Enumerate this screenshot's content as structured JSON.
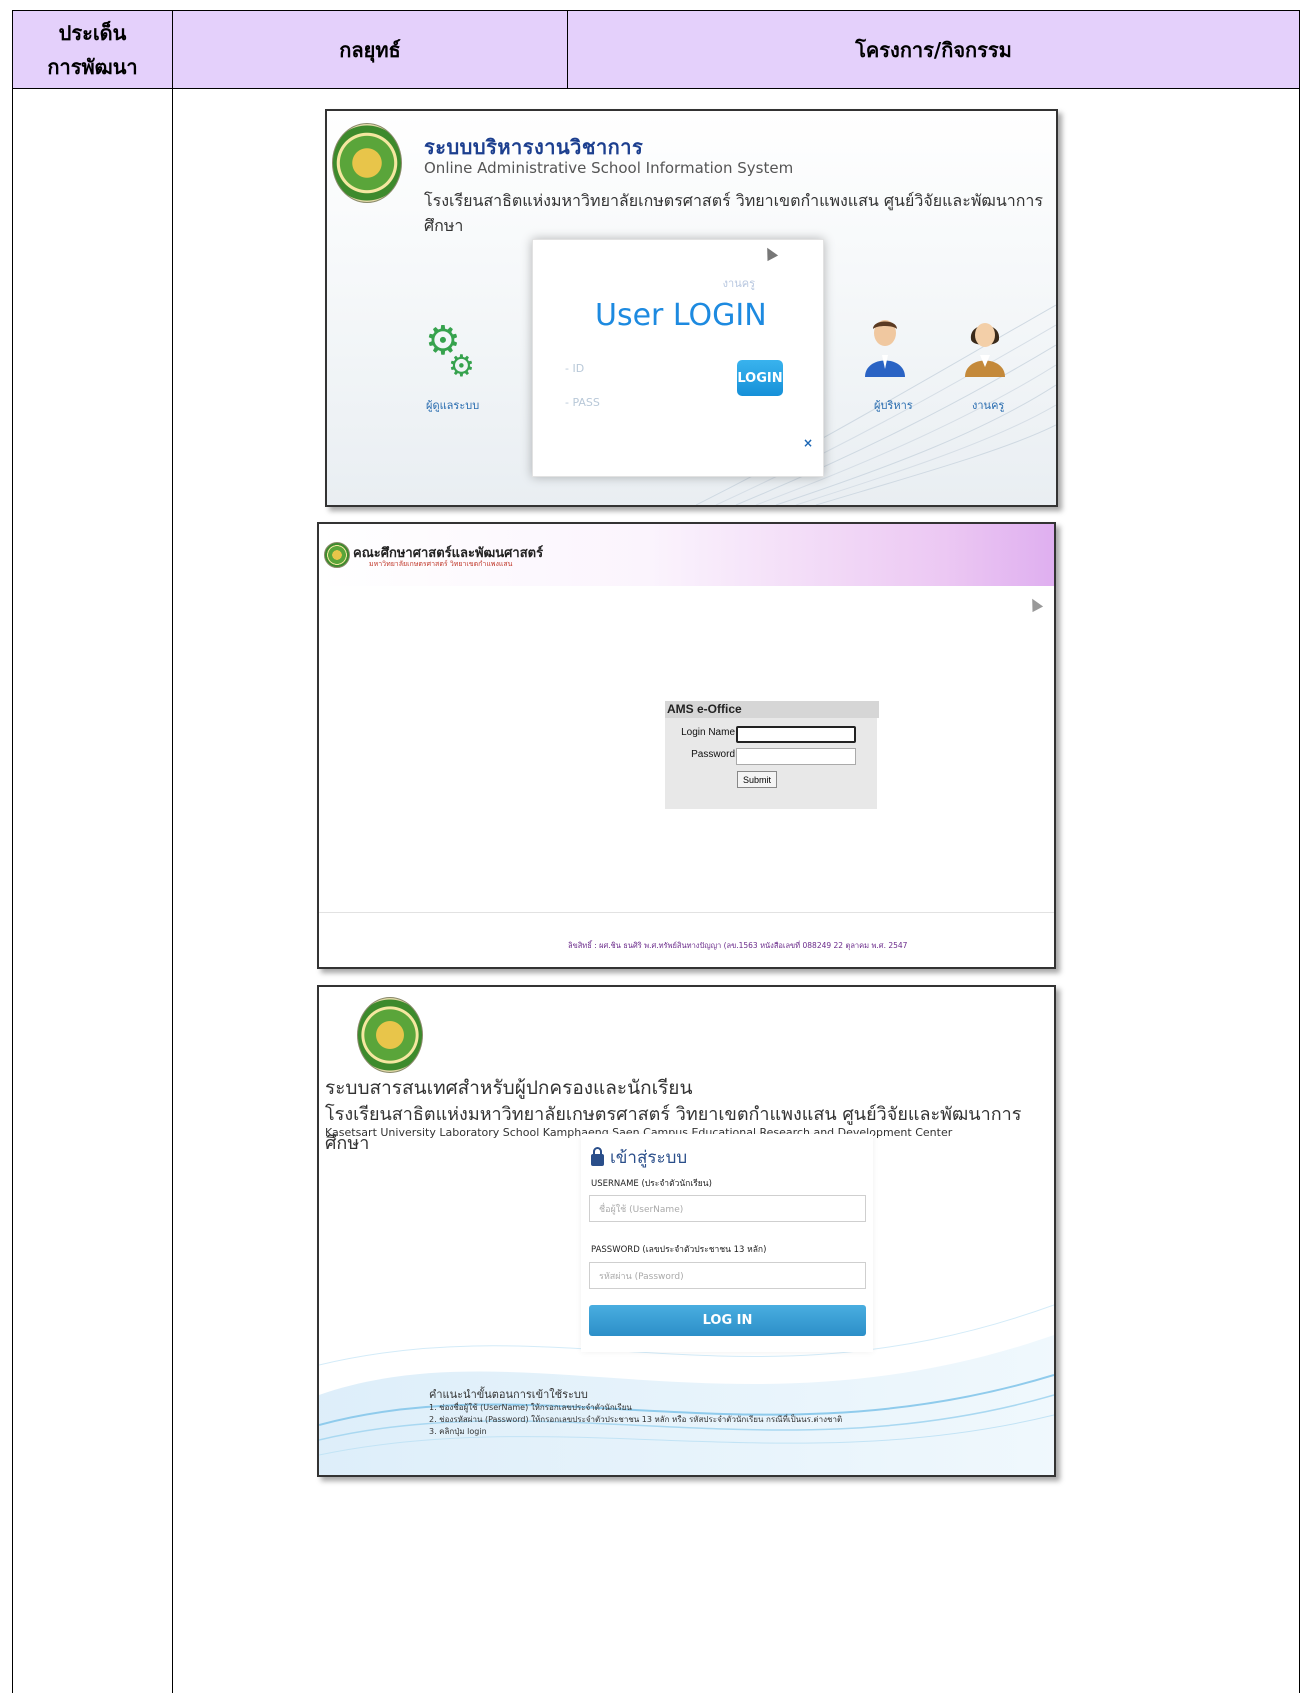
{
  "table": {
    "col1_header_line1": "ประเด็น",
    "col1_header_line2": "การพัฒนา",
    "col2_header": "กลยุทธ์",
    "col3_header": "โครงการ/กิจกรรม"
  },
  "screenshot1": {
    "title_th": "ระบบบริหารงานวิชาการ",
    "title_en": "Online Administrative School Information System",
    "school": "โรงเรียนสาธิตแห่งมหาวิทยาลัยเกษตรศาสตร์ วิทยาเขตกำแพงแสน ศูนย์วิจัยและพัฒนาการศึกษา",
    "roles": {
      "admin": "ผู้ดูแลระบบ",
      "executive": "ผู้บริหาร",
      "teacher": "งานครู"
    },
    "login": {
      "subtitle": "งานครู",
      "heading": "User LOGIN",
      "id_label": "- ID",
      "pass_label": "- PASS",
      "button": "LOGIN",
      "close": "×"
    }
  },
  "screenshot2": {
    "banner_title": "คณะศึกษาศาสตร์และพัฒนศาสตร์",
    "banner_subtitle": "มหาวิทยาลัยเกษตรศาสตร์ วิทยาเขตกำแพงแสน",
    "form_title": "AMS e-Office",
    "login_name_label": "Login Name",
    "password_label": "Password",
    "submit_label": "Submit",
    "footer": "ลิขสิทธิ์ : ผศ.ชิน ธนศิริ พ.ศ.ทรัพย์สินทางปัญญา (ลข.1563 หนังสือเลขที่ 088249 22 ตุลาคม พ.ศ. 2547"
  },
  "screenshot3": {
    "title": "ระบบสารสนเทศสำหรับผู้ปกครองและนักเรียน",
    "school_th": "โรงเรียนสาธิตแห่งมหาวิทยาลัยเกษตรศาสตร์ วิทยาเขตกำแพงแสน ศูนย์วิจัยและพัฒนาการศึกษา",
    "school_en": "Kasetsart University Laboratory School Kamphaeng Saen Campus Educational Research and Development Center",
    "login_title": "เข้าสู่ระบบ",
    "username_label": "USERNAME (ประจำตัวนักเรียน)",
    "username_placeholder": "ชื่อผู้ใช้ (UserName)",
    "password_label": "PASSWORD (เลขประจำตัวประชาชน 13 หลัก)",
    "password_placeholder": "รหัสผ่าน (Password)",
    "login_button": "LOG IN",
    "guide_title": "คำแนะนำขั้นตอนการเข้าใช้ระบบ",
    "guide_steps": [
      "1. ช่องชื่อผู้ใช้ (UserName) ให้กรอกเลขประจำตัวนักเรียน",
      "2. ช่องรหัสผ่าน (Password) ให้กรอกเลขประจำตัวประชาชน 13 หลัก หรือ รหัสประจำตัวนักเรียน กรณีที่เป็นนร.ต่างชาติ",
      "3. คลิกปุ่ม login"
    ]
  },
  "colors": {
    "header_bg": "#e4d0fb",
    "login_blue": "#1d8ae0"
  }
}
